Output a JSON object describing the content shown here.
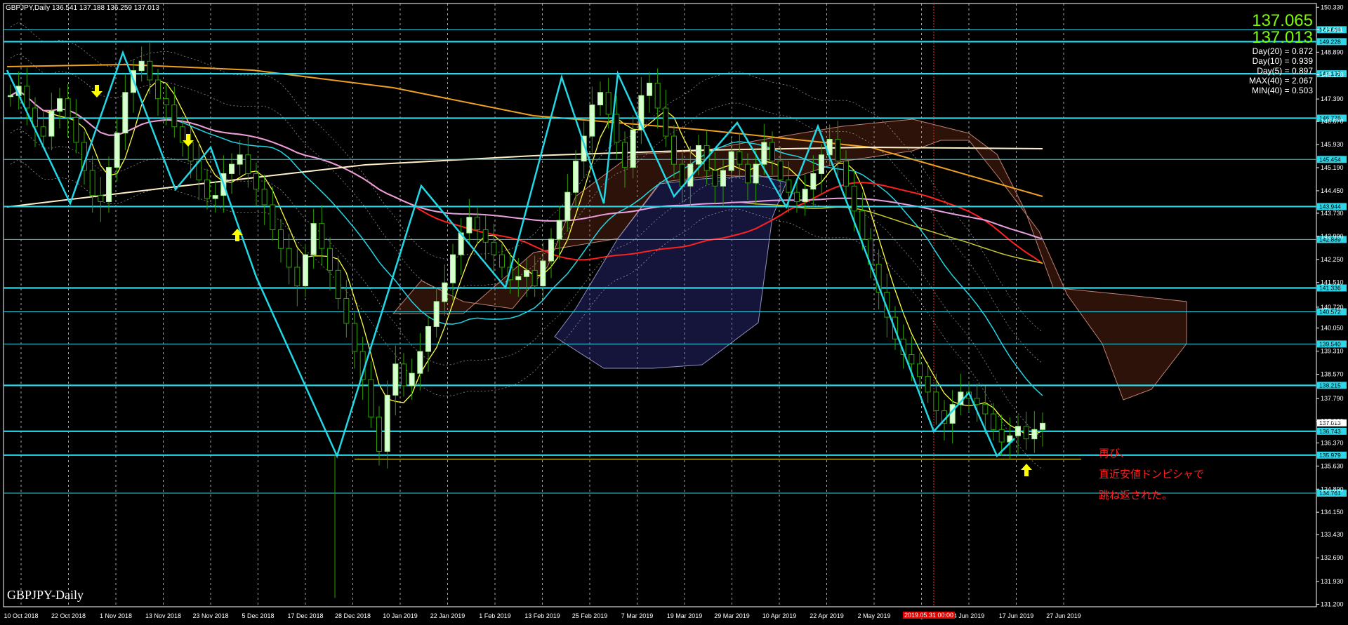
{
  "header": {
    "symbol_line": "GBPJPY,Daily  136.541 137.188 136.259 137.013"
  },
  "bottom_label": "GBPJPY-Daily",
  "info_panel": {
    "price_big_1": "137.065",
    "price_big_2": "137.013",
    "lines": [
      "Day(20) = 0.872",
      "Day(10) = 0.939",
      "Day(5) = 0.897",
      "MAX(40) = 2.067",
      "MIN(40) = 0.503"
    ]
  },
  "annotation": {
    "lines": [
      "再び、",
      "直近安値ドンピシャで",
      "跳ね返された。"
    ],
    "color": "#ff2020"
  },
  "vline_label": "2019.05.31 00:00",
  "chart_data": {
    "type": "candlestick",
    "symbol": "GBPJPY",
    "timeframe": "Daily",
    "ohlc_last": {
      "open": 136.541,
      "high": 137.188,
      "low": 136.259,
      "close": 137.013
    },
    "ylim": [
      131.12,
      150.45
    ],
    "y_tick_labels": [
      150.33,
      149.611,
      148.89,
      148.17,
      147.39,
      146.67,
      145.93,
      145.19,
      144.45,
      143.73,
      142.99,
      142.25,
      141.51,
      140.72,
      140.05,
      139.31,
      138.57,
      137.79,
      137.06,
      136.37,
      135.63,
      134.89,
      134.15,
      133.43,
      132.69,
      131.93,
      131.2
    ],
    "y_tick_text": [
      "150.330",
      "149.611",
      "148.890",
      "148.170",
      "147.390",
      "146.670",
      "145.930",
      "145.190",
      "144.450",
      "143.730",
      "142.990",
      "142.250",
      "141.510",
      "140.720",
      "140.050",
      "139.310",
      "138.570",
      "137.790",
      "137.060",
      "136.370",
      "135.630",
      "134.890",
      "134.150",
      "133.430",
      "132.690",
      "131.930",
      "131.200"
    ],
    "x_labels": [
      "10 Oct 2018",
      "22 Oct 2018",
      "1 Nov 2018",
      "13 Nov 2018",
      "23 Nov 2018",
      "5 Dec 2018",
      "17 Dec 2018",
      "28 Dec 2018",
      "10 Jan 2019",
      "22 Jan 2019",
      "1 Feb 2019",
      "13 Feb 2019",
      "25 Feb 2019",
      "7 Mar 2019",
      "19 Mar 2019",
      "29 Mar 2019",
      "10 Apr 2019",
      "22 Apr 2019",
      "2 May 2019",
      "14 May 2019",
      "4 Jun 2019",
      "17 Jun 2019",
      "27 Jun 2019"
    ],
    "horizontal_levels": [
      {
        "price": 149.611,
        "label": "149.611",
        "style": "thin"
      },
      {
        "price": 149.228,
        "label": "149.228",
        "style": "thick"
      },
      {
        "price": 148.199,
        "label": "148.199",
        "style": "thick"
      },
      {
        "price": 146.776,
        "label": "146.776",
        "style": "thick"
      },
      {
        "price": 145.454,
        "label": "145.454",
        "style": "thin"
      },
      {
        "price": 143.944,
        "label": "143.944",
        "style": "thick"
      },
      {
        "price": 142.889,
        "label": "142.889",
        "style": "thin"
      },
      {
        "price": 141.336,
        "label": "141.336",
        "style": "thick"
      },
      {
        "price": 140.572,
        "label": "140.572",
        "style": "thin"
      },
      {
        "price": 139.54,
        "label": "139.540",
        "style": "thin"
      },
      {
        "price": 138.215,
        "label": "138.215",
        "style": "thick"
      },
      {
        "price": 136.743,
        "label": "136.743",
        "style": "thick"
      },
      {
        "price": 135.979,
        "label": "135.979",
        "style": "thick"
      },
      {
        "price": 134.761,
        "label": "134.761",
        "style": "thin"
      }
    ],
    "current_price_label": "137.013",
    "support_line_price": 135.85,
    "closes": [
      147.5,
      147.8,
      147.1,
      146.5,
      146.2,
      147.0,
      147.4,
      146.8,
      146.0,
      145.1,
      144.3,
      144.1,
      145.2,
      146.3,
      147.6,
      148.3,
      148.6,
      148.0,
      147.4,
      147.2,
      146.5,
      146.0,
      145.4,
      144.8,
      144.2,
      144.3,
      145.0,
      145.3,
      145.6,
      145.0,
      144.5,
      144.0,
      143.2,
      142.6,
      142.0,
      141.4,
      142.4,
      143.4,
      142.6,
      141.9,
      141.0,
      140.2,
      139.3,
      138.4,
      137.2,
      136.1,
      137.9,
      138.9,
      138.2,
      138.6,
      139.3,
      140.1,
      140.9,
      141.5,
      142.4,
      143.1,
      143.6,
      143.2,
      142.8,
      142.4,
      142.0,
      141.6,
      141.7,
      141.9,
      141.4,
      142.2,
      142.9,
      143.5,
      144.4,
      145.4,
      146.2,
      147.2,
      147.6,
      146.9,
      146.0,
      145.2,
      146.4,
      147.5,
      147.9,
      147.1,
      146.2,
      145.3,
      144.6,
      145.3,
      145.9,
      145.1,
      144.6,
      145.1,
      145.7,
      145.3,
      144.7,
      145.3,
      146.0,
      145.4,
      144.8,
      144.4,
      144.1,
      144.5,
      145.0,
      145.6,
      146.1,
      145.4,
      144.6,
      143.8,
      142.9,
      142.1,
      141.2,
      140.4,
      139.7,
      139.2,
      138.9,
      138.5,
      138.0,
      137.4,
      137.0,
      137.6,
      138.0,
      137.8,
      137.6,
      137.3,
      136.8,
      136.4,
      136.6,
      136.9,
      136.5,
      136.8,
      137.0
    ]
  }
}
